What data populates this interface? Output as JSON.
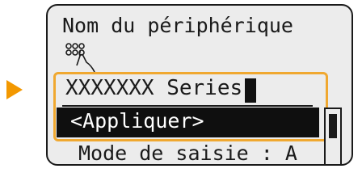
{
  "screen": {
    "title": "Nom du périphérique",
    "input_icon": "keyboard-hand-icon",
    "device_name_value": "XXXXXXX Series",
    "apply_label": "<Appliquer>",
    "input_mode_label": "Mode de saisie : A"
  },
  "colors": {
    "pointer": "#f39800",
    "highlight_border": "#f0a830",
    "screen_bg": "#ececec",
    "selected_row_bg": "#0f0f0f"
  }
}
